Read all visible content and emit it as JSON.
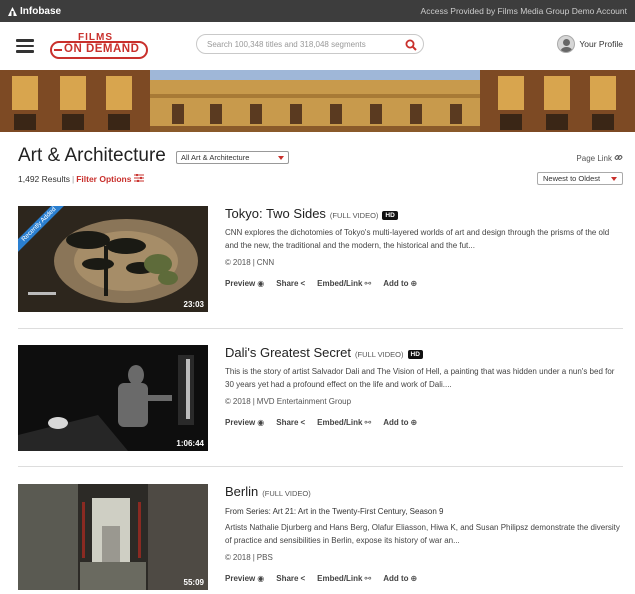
{
  "topbar": {
    "brand": "Infobase",
    "access_text": "Access Provided by Films Media Group Demo Account"
  },
  "header": {
    "logo_top": "FILMS",
    "logo_bottom": "ON DEMAND",
    "search_placeholder": "Search 100,348 titles and 318,048 segments",
    "profile_label": "Your Profile"
  },
  "page": {
    "title": "Art & Architecture",
    "category_select": "All Art & Architecture",
    "page_link": "Page Link",
    "results_count": "1,492 Results",
    "filter_options": "Filter Options",
    "sort_select": "Newest to Oldest"
  },
  "actions": {
    "preview": "Preview",
    "share": "Share",
    "embed": "Embed/Link",
    "add": "Add to"
  },
  "items": [
    {
      "title": "Tokyo: Two Sides",
      "kind": "(FULL VIDEO)",
      "hd": "HD",
      "series": "",
      "description": "CNN explores the dichotomies of Tokyo's multi-layered worlds of art and design through the prisms of the old and the new, the traditional and the modern, the historical and the fut...",
      "year": "2018",
      "publisher": "CNN",
      "duration": "23:03",
      "badge": "Recently Added"
    },
    {
      "title": "Dali's Greatest Secret",
      "kind": "(FULL VIDEO)",
      "hd": "HD",
      "series": "",
      "description": "This is the story of artist Salvador Dali and The Vision of Hell, a painting that was hidden under a nun's bed for 30 years yet had a profound effect on the life and work of Dali....",
      "year": "2018",
      "publisher": "MVD Entertainment Group",
      "duration": "1:06:44",
      "badge": ""
    },
    {
      "title": "Berlin",
      "kind": "(FULL VIDEO)",
      "hd": "",
      "series": "From Series: Art 21: Art in the Twenty-First Century, Season 9",
      "description": "Artists Nathalie Djurberg and Hans Berg, Olafur Eliasson, Hiwa K, and Susan Philipsz demonstrate the diversity of practice and sensibilities in Berlin, expose its history of war an...",
      "year": "2018",
      "publisher": "PBS",
      "duration": "55:09",
      "badge": ""
    }
  ],
  "colors": {
    "accent": "#c9302c",
    "topbar": "#3d3d3d",
    "ribbon": "#2a7fd0"
  }
}
